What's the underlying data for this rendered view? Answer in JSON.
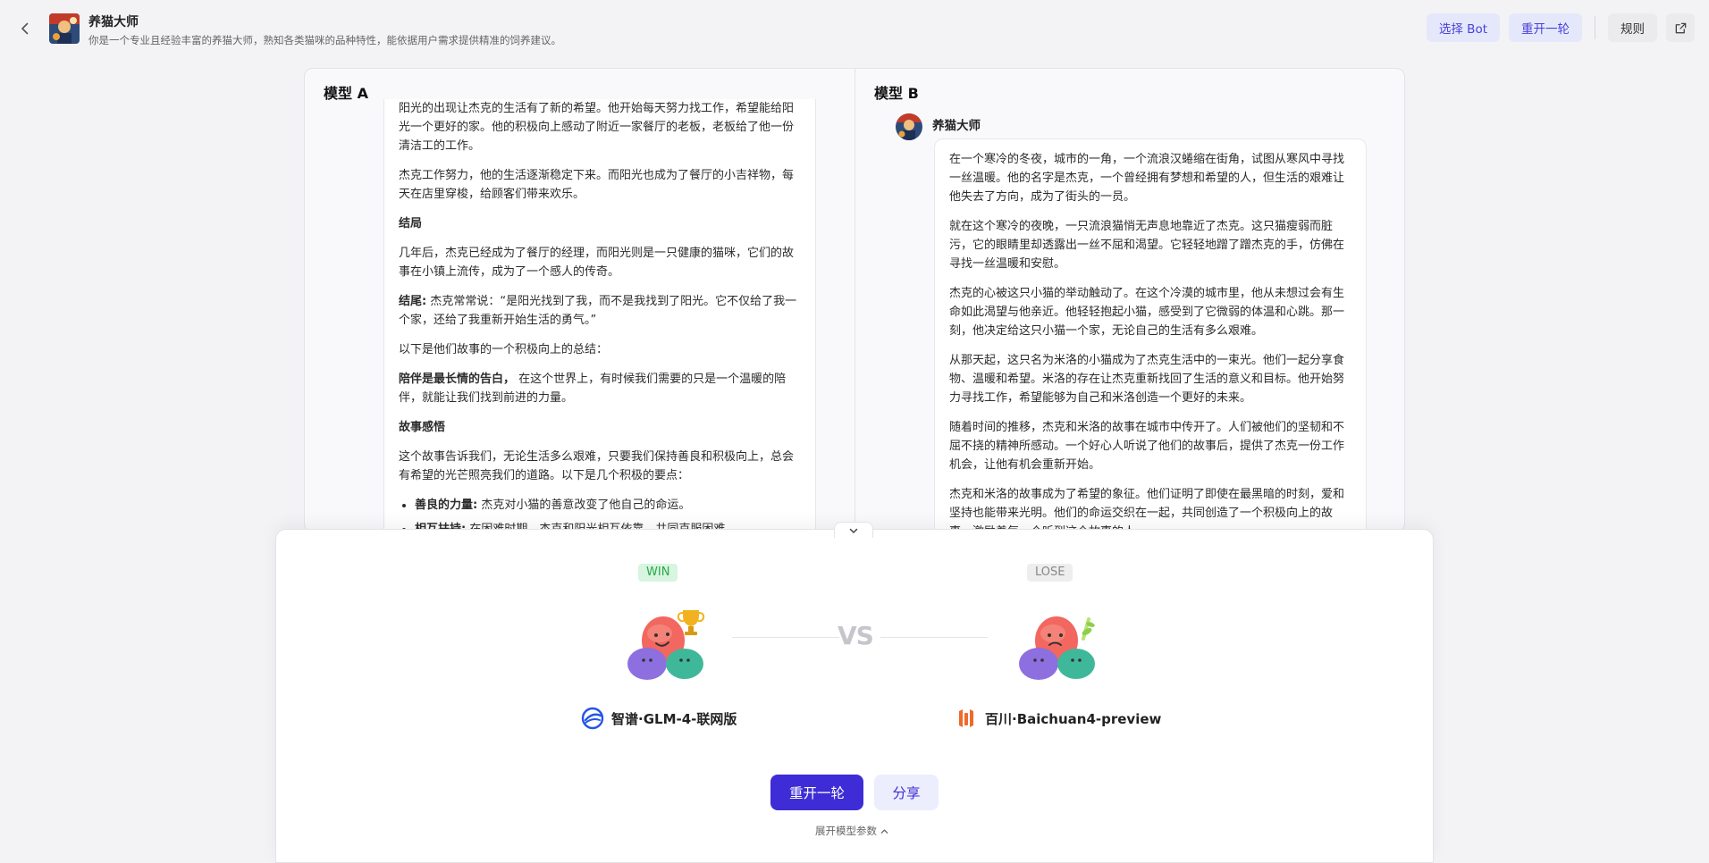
{
  "header": {
    "bot_name": "养猫大师",
    "bot_description": "你是一个专业且经验丰富的养猫大师，熟知各类猫咪的品种特性，能依据用户需求提供精准的饲养建议。",
    "buttons": {
      "select_bot": "选择 Bot",
      "restart": "重开一轮",
      "rules": "规则"
    },
    "icons": {
      "back": "chevron-left-icon",
      "share": "share-icon"
    }
  },
  "panel_a": {
    "title": "模型 A",
    "content": {
      "p0": "阳光的出现让杰克的生活有了新的希望。他开始每天努力找工作，希望能给阳光一个更好的家。他的积极向上感动了附近一家餐厅的老板，老板给了他一份清洁工的工作。",
      "p1": "杰克工作努力，他的生活逐渐稳定下来。而阳光也成为了餐厅的小吉祥物，每天在店里穿梭，给顾客们带来欢乐。",
      "h_ending": "结局",
      "p2": "几年后，杰克已经成为了餐厅的经理，而阳光则是一只健康的猫咪，它们的故事在小镇上流传，成为了一个感人的传奇。",
      "ending_label": "结尾:",
      "ending_text": "杰克常常说：“是阳光找到了我，而不是我找到了阳光。它不仅给了我一个家，还给了我重新开始生活的勇气。”",
      "p3": "以下是他们故事的一个积极向上的总结：",
      "accompany_label": "陪伴是最长情的告白，",
      "accompany_text": "在这个世界上，有时候我们需要的只是一个温暖的陪伴，就能让我们找到前进的力量。",
      "h_insight": "故事感悟",
      "p4": "这个故事告诉我们，无论生活多么艰难，只要我们保持善良和积极向上，总会有希望的光芒照亮我们的道路。以下是几个积极的要点：",
      "bullets": [
        {
          "label": "善良的力量:",
          "text": "杰克对小猫的善意改变了他自己的命运。"
        },
        {
          "label": "相互扶持:",
          "text": "在困难时期，杰克和阳光相互依靠，共同克服困难。"
        }
      ]
    }
  },
  "panel_b": {
    "title": "模型 B",
    "sender_name": "养猫大师",
    "content": {
      "p1": "在一个寒冷的冬夜，城市的一角，一个流浪汉蜷缩在街角，试图从寒风中寻找一丝温暖。他的名字是杰克，一个曾经拥有梦想和希望的人，但生活的艰难让他失去了方向，成为了街头的一员。",
      "p2": "就在这个寒冷的夜晚，一只流浪猫悄无声息地靠近了杰克。这只猫瘦弱而脏污，它的眼睛里却透露出一丝不屈和渴望。它轻轻地蹭了蹭杰克的手，仿佛在寻找一丝温暖和安慰。",
      "p3": "杰克的心被这只小猫的举动触动了。在这个冷漠的城市里，他从未想过会有生命如此渴望与他亲近。他轻轻抱起小猫，感受到了它微弱的体温和心跳。那一刻，他决定给这只小猫一个家，无论自己的生活有多么艰难。",
      "p4": "从那天起，这只名为米洛的小猫成为了杰克生活中的一束光。他们一起分享食物、温暖和希望。米洛的存在让杰克重新找回了生活的意义和目标。他开始努力寻找工作，希望能够为自己和米洛创造一个更好的未来。",
      "p5": "随着时间的推移，杰克和米洛的故事在城市中传开了。人们被他们的坚韧和不屈不挠的精神所感动。一个好心人听说了他们的故事后，提供了杰克一份工作机会，让他有机会重新开始。",
      "p6": "杰克和米洛的故事成为了希望的象征。他们证明了即使在最黑暗的时刻，爱和坚持也能带来光明。他们的命运交织在一起，共同创造了一个积极向上的故事，激励着每一个听到这个故事的人。"
    }
  },
  "result": {
    "left": {
      "badge": "WIN",
      "model_name": "智谱·GLM-4-联网版",
      "logo_icon": "zhipu-logo-icon"
    },
    "right": {
      "badge": "LOSE",
      "model_name": "百川·Baichuan4-preview",
      "logo_icon": "baichuan-logo-icon"
    },
    "vs": "VS",
    "buttons": {
      "restart": "重开一轮",
      "share": "分享"
    },
    "expand_params": "展开模型参数",
    "colors": {
      "primary": "#3e2cd6",
      "win": "#29a84b",
      "lose": "#888888"
    }
  }
}
